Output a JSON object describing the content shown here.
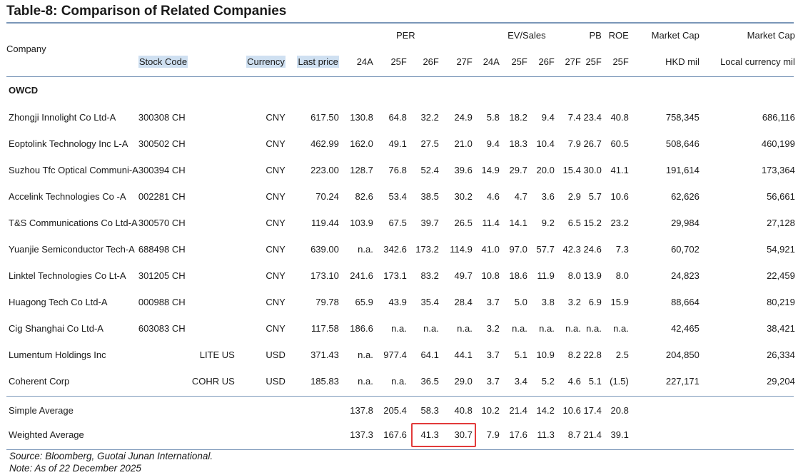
{
  "title": "Table-8: Comparison of Related Companies",
  "headers": {
    "company": "Company",
    "per": "PER",
    "ev_sales": "EV/Sales",
    "pb": "PB",
    "roe": "ROE",
    "mcap1": "Market Cap",
    "mcap2": "Market Cap",
    "stock_code": "Stock Code",
    "currency": "Currency",
    "last_price": "Last price",
    "per_24a": "24A",
    "per_25f": "25F",
    "per_26f": "26F",
    "per_27f": "27F",
    "ev_24a": "24A",
    "ev_25f": "25F",
    "ev_26f": "26F",
    "ev_27f": "27F",
    "pb_25f": "25F",
    "roe_25f": "25F",
    "hkd_mil": "HKD mil",
    "local_mil": "Local currency mil"
  },
  "section": "OWCD",
  "rows": [
    {
      "company": "Zhongji Innolight Co Ltd-A",
      "code": "300308 CH",
      "currency": "CNY",
      "price": "617.50",
      "per24": "130.8",
      "per25": "64.8",
      "per26": "32.2",
      "per27": "24.9",
      "ev24": "5.8",
      "ev25": "18.2",
      "ev26": "9.4",
      "ev27": "7.4",
      "pb25": "23.4",
      "roe25": "40.8",
      "hkd": "758,345",
      "local": "686,116"
    },
    {
      "company": "Eoptolink Technology Inc L-A",
      "code": "300502 CH",
      "currency": "CNY",
      "price": "462.99",
      "per24": "162.0",
      "per25": "49.1",
      "per26": "27.5",
      "per27": "21.0",
      "ev24": "9.4",
      "ev25": "18.3",
      "ev26": "10.4",
      "ev27": "7.9",
      "pb25": "26.7",
      "roe25": "60.5",
      "hkd": "508,646",
      "local": "460,199"
    },
    {
      "company": "Suzhou Tfc Optical Communi-A",
      "code": "300394 CH",
      "currency": "CNY",
      "price": "223.00",
      "per24": "128.7",
      "per25": "76.8",
      "per26": "52.4",
      "per27": "39.6",
      "ev24": "14.9",
      "ev25": "29.7",
      "ev26": "20.0",
      "ev27": "15.4",
      "pb25": "30.0",
      "roe25": "41.1",
      "hkd": "191,614",
      "local": "173,364"
    },
    {
      "company": "Accelink Technologies Co -A",
      "code": "002281 CH",
      "currency": "CNY",
      "price": "70.24",
      "per24": "82.6",
      "per25": "53.4",
      "per26": "38.5",
      "per27": "30.2",
      "ev24": "4.6",
      "ev25": "4.7",
      "ev26": "3.6",
      "ev27": "2.9",
      "pb25": "5.7",
      "roe25": "10.6",
      "hkd": "62,626",
      "local": "56,661"
    },
    {
      "company": "T&S Communications Co Ltd-A",
      "code": "300570 CH",
      "currency": "CNY",
      "price": "119.44",
      "per24": "103.9",
      "per25": "67.5",
      "per26": "39.7",
      "per27": "26.5",
      "ev24": "11.4",
      "ev25": "14.1",
      "ev26": "9.2",
      "ev27": "6.5",
      "pb25": "15.2",
      "roe25": "23.2",
      "hkd": "29,984",
      "local": "27,128"
    },
    {
      "company": "Yuanjie Semiconductor Tech-A",
      "code": "688498 CH",
      "currency": "CNY",
      "price": "639.00",
      "per24": "n.a.",
      "per25": "342.6",
      "per26": "173.2",
      "per27": "114.9",
      "ev24": "41.0",
      "ev25": "97.0",
      "ev26": "57.7",
      "ev27": "42.3",
      "pb25": "24.6",
      "roe25": "7.3",
      "hkd": "60,702",
      "local": "54,921"
    },
    {
      "company": "Linktel Technologies Co Lt-A",
      "code": "301205 CH",
      "currency": "CNY",
      "price": "173.10",
      "per24": "241.6",
      "per25": "173.1",
      "per26": "83.2",
      "per27": "49.7",
      "ev24": "10.8",
      "ev25": "18.6",
      "ev26": "11.9",
      "ev27": "8.0",
      "pb25": "13.9",
      "roe25": "8.0",
      "hkd": "24,823",
      "local": "22,459"
    },
    {
      "company": "Huagong Tech Co Ltd-A",
      "code": "000988 CH",
      "currency": "CNY",
      "price": "79.78",
      "per24": "65.9",
      "per25": "43.9",
      "per26": "35.4",
      "per27": "28.4",
      "ev24": "3.7",
      "ev25": "5.0",
      "ev26": "3.8",
      "ev27": "3.2",
      "pb25": "6.9",
      "roe25": "15.9",
      "hkd": "88,664",
      "local": "80,219"
    },
    {
      "company": "Cig Shanghai Co Ltd-A",
      "code": "603083 CH",
      "currency": "CNY",
      "price": "117.58",
      "per24": "186.6",
      "per25": "n.a.",
      "per26": "n.a.",
      "per27": "n.a.",
      "ev24": "3.2",
      "ev25": "n.a.",
      "ev26": "n.a.",
      "ev27": "n.a.",
      "pb25": "n.a.",
      "roe25": "n.a.",
      "hkd": "42,465",
      "local": "38,421"
    },
    {
      "company": "Lumentum Holdings Inc",
      "code": "LITE US",
      "currency": "USD",
      "price": "371.43",
      "per24": "n.a.",
      "per25": "977.4",
      "per26": "64.1",
      "per27": "44.1",
      "ev24": "3.7",
      "ev25": "5.1",
      "ev26": "10.9",
      "ev27": "8.2",
      "pb25": "22.8",
      "roe25": "2.5",
      "hkd": "204,850",
      "local": "26,334"
    },
    {
      "company": "Coherent Corp",
      "code": "COHR US",
      "currency": "USD",
      "price": "185.83",
      "per24": "n.a.",
      "per25": "n.a.",
      "per26": "36.5",
      "per27": "29.0",
      "ev24": "3.7",
      "ev25": "3.4",
      "ev26": "5.2",
      "ev27": "4.6",
      "pb25": "5.1",
      "roe25": "(1.5)",
      "hkd": "227,171",
      "local": "29,204"
    }
  ],
  "averages": [
    {
      "label": "Simple Average",
      "per24": "137.8",
      "per25": "205.4",
      "per26": "58.3",
      "per27": "40.8",
      "ev24": "10.2",
      "ev25": "21.4",
      "ev26": "14.2",
      "ev27": "10.6",
      "pb25": "17.4",
      "roe25": "20.8"
    },
    {
      "label": "Weighted Average",
      "per24": "137.3",
      "per25": "167.6",
      "per26": "41.3",
      "per27": "30.7",
      "ev24": "7.9",
      "ev25": "17.6",
      "ev26": "11.3",
      "ev27": "8.7",
      "pb25": "21.4",
      "roe25": "39.1"
    }
  ],
  "source": "Source: Bloomberg, Guotai Junan International.",
  "note": "Note: As of 22 December 2025",
  "colors": {
    "rule": "#7a96b8",
    "highlight_bg": "#cfe0f1",
    "annotation_box": "#e23a3a"
  }
}
